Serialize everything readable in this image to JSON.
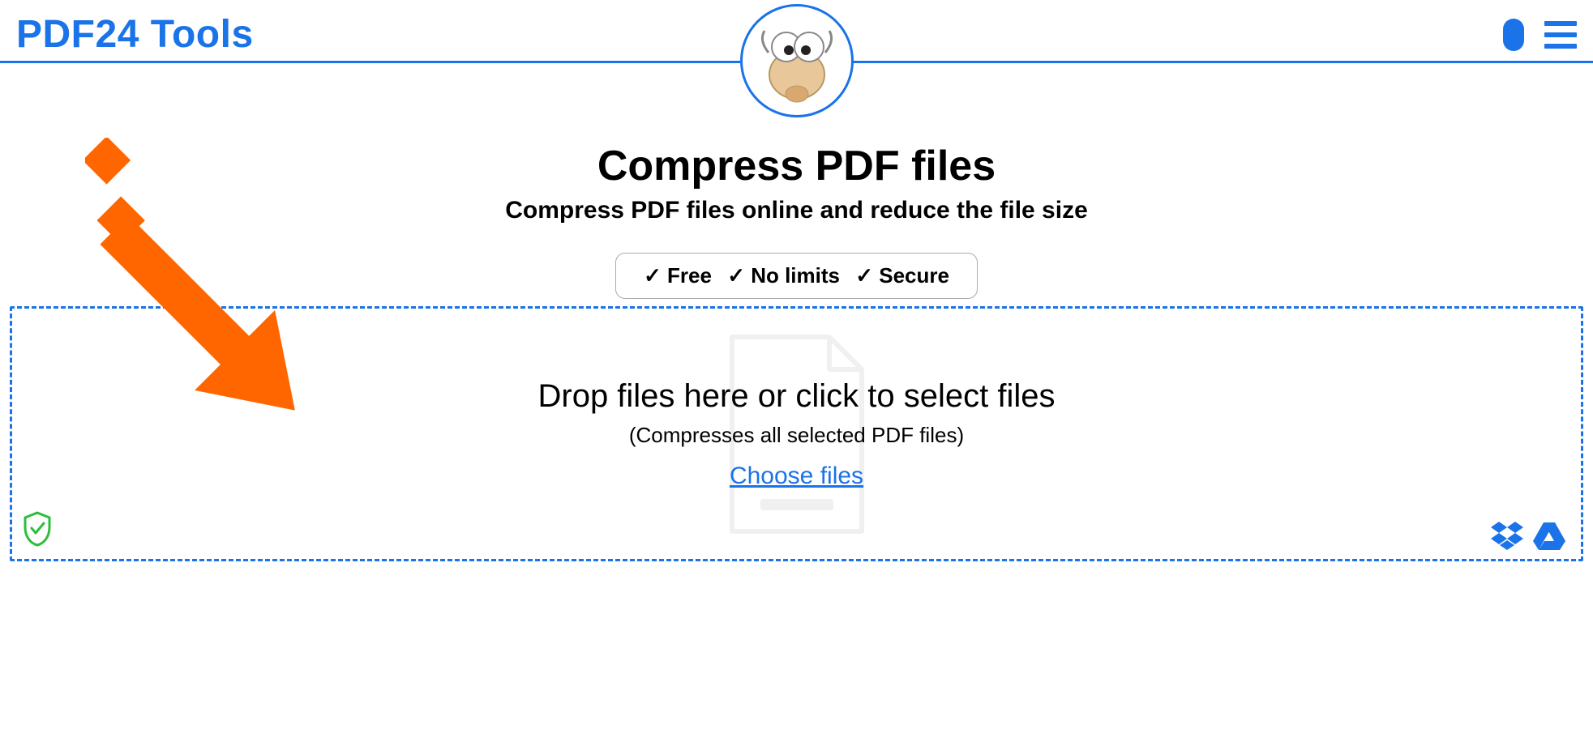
{
  "header": {
    "logo": "PDF24 Tools"
  },
  "page": {
    "title": "Compress PDF files",
    "subtitle": "Compress PDF files online and reduce the file size",
    "badges": {
      "free": "✓ Free",
      "nolimits": "✓ No limits",
      "secure": "✓ Secure"
    }
  },
  "dropzone": {
    "title": "Drop files here or click to select files",
    "subtitle": "(Compresses all selected PDF files)",
    "choose": "Choose files"
  }
}
